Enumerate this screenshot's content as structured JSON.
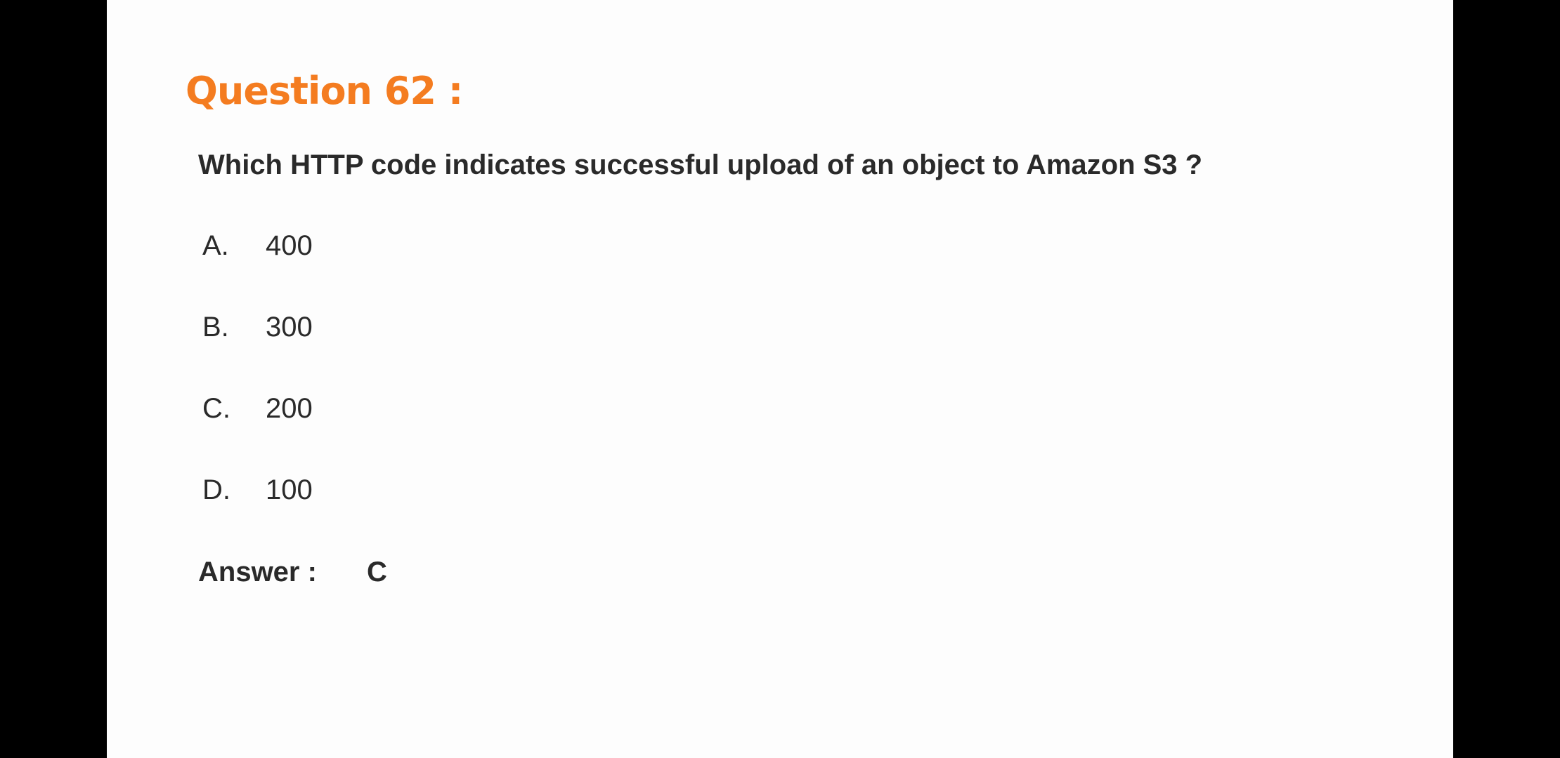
{
  "slide": {
    "title": "Question 62 :",
    "question": "Which HTTP code indicates successful upload of an object to Amazon S3 ?",
    "options": [
      {
        "letter": "A.",
        "value": "400"
      },
      {
        "letter": "B.",
        "value": "300"
      },
      {
        "letter": "C.",
        "value": "200"
      },
      {
        "letter": "D.",
        "value": "100"
      }
    ],
    "answer_label": "Answer :",
    "answer_value": "C"
  },
  "colors": {
    "title": "#f47c20",
    "text": "#2a2a2a",
    "slide_background": "#fdfdfd",
    "letterbox": "#000000"
  }
}
